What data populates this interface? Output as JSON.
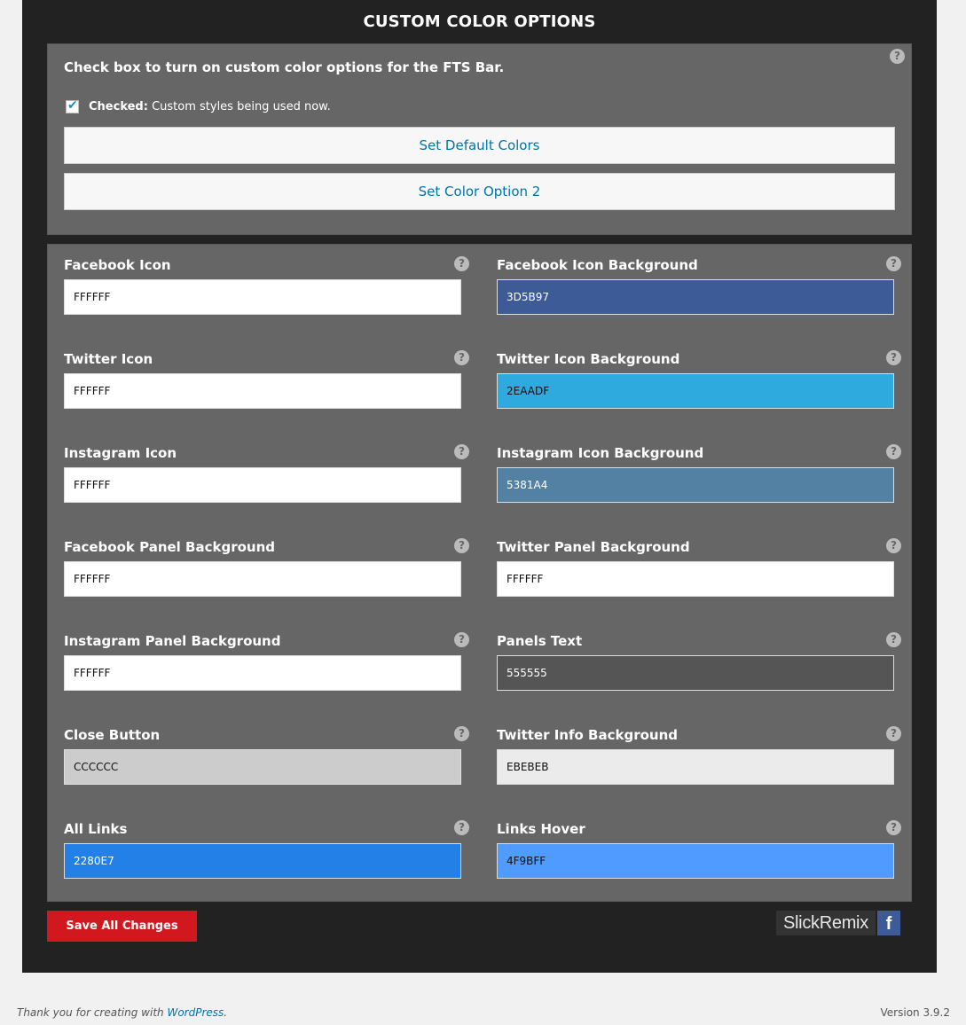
{
  "title": "CUSTOM COLOR OPTIONS",
  "intro": "Check box to turn on custom color options for the FTS Bar.",
  "checkbox": {
    "checked": true,
    "label_bold": "Checked:",
    "label_text": " Custom styles being used now."
  },
  "buttons": {
    "default_colors": "Set Default Colors",
    "color_option_2": "Set Color Option 2"
  },
  "help_glyph": "?",
  "fields": [
    {
      "label": "Facebook Icon",
      "value": "FFFFFF",
      "bg": "#ffffff",
      "fg": "#111111"
    },
    {
      "label": "Facebook Icon Background",
      "value": "3D5B97",
      "bg": "#3d5b97",
      "fg": "#ffffff"
    },
    {
      "label": "Twitter Icon",
      "value": "FFFFFF",
      "bg": "#ffffff",
      "fg": "#111111"
    },
    {
      "label": "Twitter Icon Background",
      "value": "2EAADF",
      "bg": "#2eaadf",
      "fg": "#111111"
    },
    {
      "label": "Instagram Icon",
      "value": "FFFFFF",
      "bg": "#ffffff",
      "fg": "#111111"
    },
    {
      "label": "Instagram Icon Background",
      "value": "5381A4",
      "bg": "#5381a4",
      "fg": "#ffffff"
    },
    {
      "label": "Facebook Panel Background",
      "value": "FFFFFF",
      "bg": "#ffffff",
      "fg": "#111111"
    },
    {
      "label": "Twitter Panel Background",
      "value": "FFFFFF",
      "bg": "#ffffff",
      "fg": "#111111"
    },
    {
      "label": "Instagram Panel Background",
      "value": "FFFFFF",
      "bg": "#ffffff",
      "fg": "#111111"
    },
    {
      "label": "Panels Text",
      "value": "555555",
      "bg": "#555555",
      "fg": "#ffffff"
    },
    {
      "label": "Close Button",
      "value": "CCCCCC",
      "bg": "#cccccc",
      "fg": "#111111"
    },
    {
      "label": "Twitter Info Background",
      "value": "EBEBEB",
      "bg": "#ebebeb",
      "fg": "#111111"
    },
    {
      "label": "All Links",
      "value": "2280E7",
      "bg": "#2280e7",
      "fg": "#ffffff"
    },
    {
      "label": "Links Hover",
      "value": "4F9BFF",
      "bg": "#4f9bff",
      "fg": "#111111"
    }
  ],
  "save_button": "Save All Changes",
  "brand": {
    "name": "SlickRemix",
    "fb_glyph": "f"
  },
  "footer": {
    "thanks": "Thank you for creating with ",
    "link": "WordPress",
    "link_suffix": ".",
    "version": "Version 3.9.2"
  }
}
